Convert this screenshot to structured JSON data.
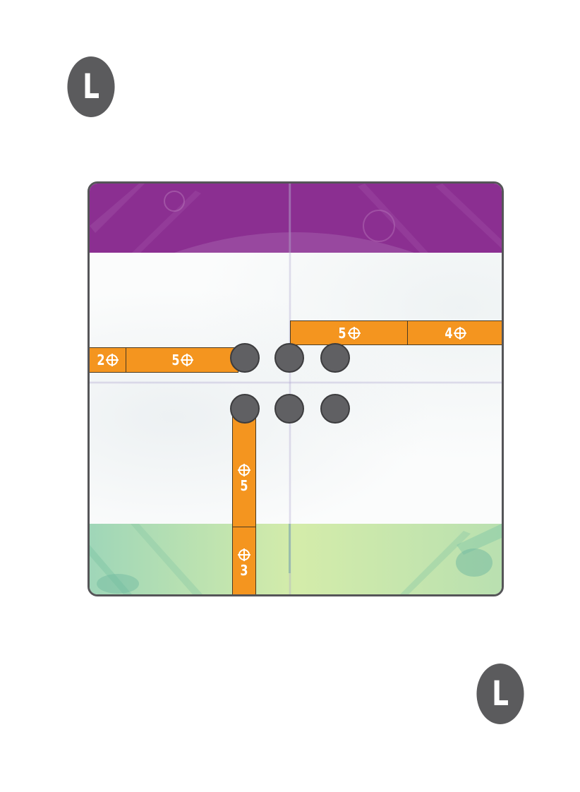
{
  "colors": {
    "badge": "#5b5b5d",
    "board_border": "#555558",
    "top_zone": "#8b2f91",
    "bottom_zone": "#c9e8a8",
    "strip": "#f4951f",
    "token": "#606063"
  },
  "corner_marks": {
    "top_left": "L",
    "bottom_right": "L"
  },
  "strips": {
    "upper_right_a": "5",
    "upper_right_b": "4",
    "left_a": "2",
    "left_b": "5",
    "lower_a": "5",
    "lower_b": "3"
  },
  "icons": {
    "target": "crosshair-target-icon"
  },
  "tokens": {
    "count": 6
  }
}
